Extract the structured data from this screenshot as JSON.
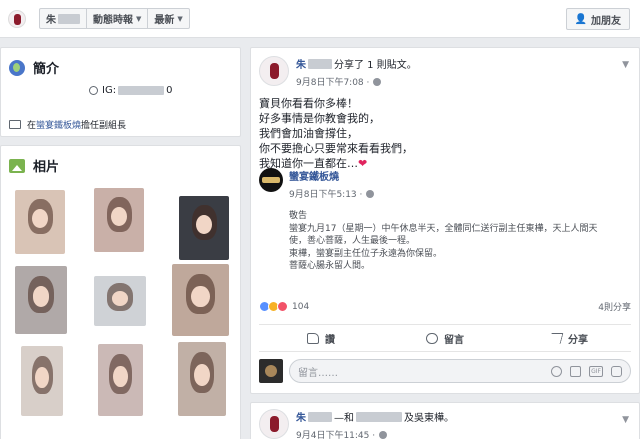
{
  "topbar": {
    "name_prefix": "朱",
    "dropdown1_label": "動態時報",
    "dropdown2_label": "最新",
    "add_friend_label": "加朋友"
  },
  "intro": {
    "title": "簡介",
    "ig_label": "IG:",
    "ig_suffix": "0",
    "work_prefix": "在",
    "work_place": "蠻宴鐵板燒",
    "work_role": "擔任副組長"
  },
  "photos": {
    "title": "相片",
    "tiles": [
      {
        "bg": "#d9c4b6"
      },
      {
        "bg": "#c9b0a8"
      },
      {
        "bg": "#3a3d44"
      },
      {
        "bg": "#b0a9a8"
      },
      {
        "bg": "#cfd2d6"
      },
      {
        "bg": "#bfa89b"
      },
      {
        "bg": "#d8cfc9"
      },
      {
        "bg": "#cbb9b6"
      },
      {
        "bg": "#c1b0a6"
      }
    ]
  },
  "post1": {
    "name_prefix": "朱",
    "action": "分享了 1 則貼文。",
    "time": "9月8日下午7:08 ·",
    "lines": [
      "寶貝你看看你多棒！",
      "好多事情是你教會我的，",
      "我們會加油會撐住，",
      "你不要擔心只要常來看看我們，",
      "我知道你一直都在…"
    ],
    "heart": "❤",
    "shared": {
      "name": "蠻宴鐵板燒",
      "time": "9月8日下午5:13 ·",
      "body": [
        "敬告",
        "蠻宴九月17（星期一）中午休息半天，全體同仁送行副主任東樺，天上人間天",
        "使，善心菩薩，人生最後一程。",
        "東樺，蠻宴副主任位子永遠為你保留。",
        "菩薩心腸永留人間。"
      ]
    },
    "reaction_count": "104",
    "share_count": "4則分享",
    "actions": {
      "like": "讚",
      "comment": "留言",
      "share": "分享"
    },
    "comment_placeholder": "留言……",
    "gif_label": "GIF"
  },
  "post2": {
    "name_prefix": "朱",
    "action_mid": "—和",
    "action_end": "及吳東樺。",
    "time": "9月4日下午11:45 ·"
  },
  "colors": {
    "link": "#365899",
    "background": "#e9ebee",
    "heart": "#e0245e"
  }
}
